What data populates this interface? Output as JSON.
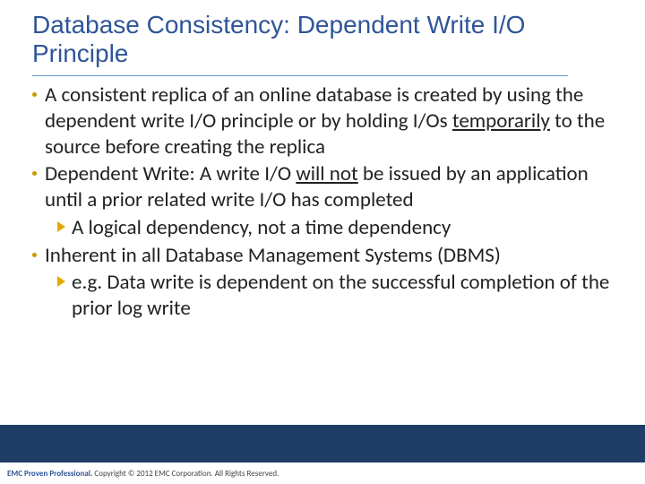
{
  "title": "Database Consistency: Dependent Write I/O Principle",
  "bullets": {
    "b1_pre": "A consistent replica of an online database is created by using the dependent write I/O principle or by holding I/Os ",
    "b1_u": "temporarily",
    "b1_post": " to the source before creating the replica",
    "b2_pre": "Dependent Write: A write I/O ",
    "b2_u": "will not",
    "b2_post": " be issued by an application until a prior related write I/O has completed",
    "b2_sub": "A logical dependency, not a time dependency",
    "b3": "Inherent in all Database Management Systems (DBMS)",
    "b3_sub": "e.g. Data write is dependent on the successful completion of the prior log write"
  },
  "footer": {
    "brand": "EMC Proven Professional.",
    "rest": " Copyright © 2012 EMC Corporation. All Rights Reserved."
  }
}
